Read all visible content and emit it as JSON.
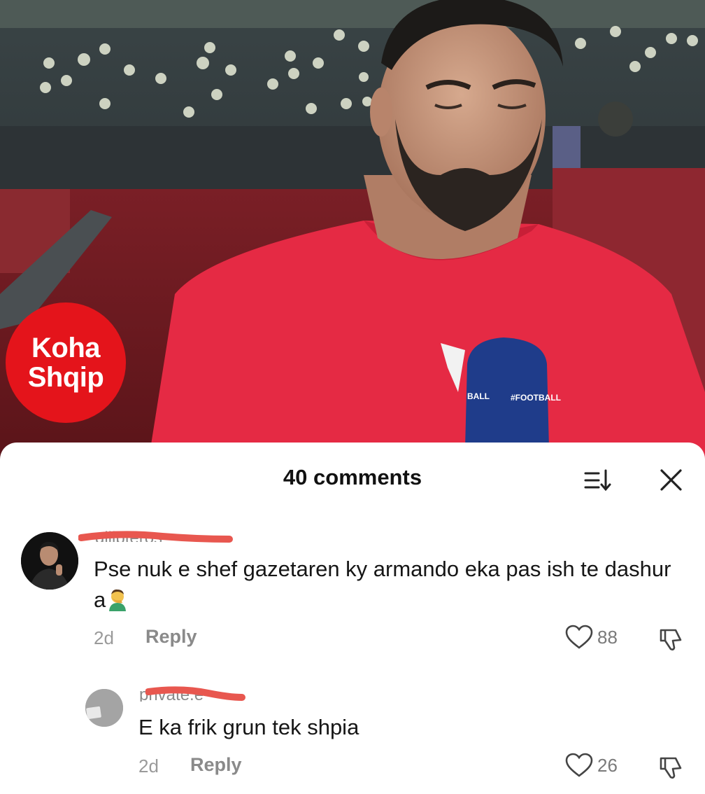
{
  "video": {
    "logo_line1": "Koha",
    "logo_line2": "Shqip",
    "mic_text_left": "BALL",
    "mic_text_right": "#FOOTBALL"
  },
  "sheet": {
    "title": "40 comments",
    "sort_icon": "sort-icon",
    "close_icon": "close-icon"
  },
  "comments": [
    {
      "username": "gilipteros",
      "text": "Pse nuk e shef gazetaren ky armando eka pas ish te dashur a",
      "emoji": "🤦‍♂️",
      "age": "2d",
      "reply_label": "Reply",
      "likes": "88"
    },
    {
      "username": "private.e",
      "text": "E ka frik grun tek shpia",
      "age": "2d",
      "reply_label": "Reply",
      "likes": "26"
    }
  ],
  "colors": {
    "brand_red": "#e4141b",
    "redaction": "#e8574f",
    "jersey": "#e52a44"
  }
}
